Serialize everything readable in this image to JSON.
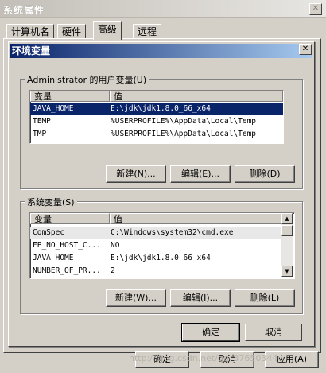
{
  "outer": {
    "title": "系统属性",
    "close_glyph": "✕",
    "tabs": [
      "计算机名",
      "硬件",
      "高级",
      "远程"
    ],
    "ok_label": "确定",
    "cancel_label": "取消",
    "apply_label": "应用(A)"
  },
  "dialog": {
    "title": "环境变量",
    "close_glyph": "✕",
    "user_group_label": "Administrator 的用户变量(U)",
    "system_group_label": "系统变量(S)",
    "col_var": "变量",
    "col_val": "值",
    "user_vars": [
      {
        "name": "JAVA_HOME",
        "value": "E:\\jdk\\jdk1.8.0_66_x64",
        "selected": true
      },
      {
        "name": "TEMP",
        "value": "%USERPROFILE%\\AppData\\Local\\Temp",
        "selected": false
      },
      {
        "name": "TMP",
        "value": "%USERPROFILE%\\AppData\\Local\\Temp",
        "selected": false
      }
    ],
    "system_vars": [
      {
        "name": "ComSpec",
        "value": "C:\\Windows\\system32\\cmd.exe"
      },
      {
        "name": "FP_NO_HOST_C...",
        "value": "NO"
      },
      {
        "name": "JAVA_HOME",
        "value": "E:\\jdk\\jdk1.8.0_66_x64"
      },
      {
        "name": "NUMBER_OF_PR...",
        "value": "2"
      }
    ],
    "user_new": "新建(N)...",
    "user_edit": "编辑(E)...",
    "user_delete": "删除(D)",
    "sys_new": "新建(W)...",
    "sys_edit": "编辑(I)...",
    "sys_delete": "删除(L)",
    "ok_label": "确定",
    "cancel_label": "取消"
  },
  "watermark": "http://blog.csdn.net/qq_37650344",
  "icons": [
    "close-icon",
    "scroll-up-icon",
    "scroll-down-icon"
  ]
}
